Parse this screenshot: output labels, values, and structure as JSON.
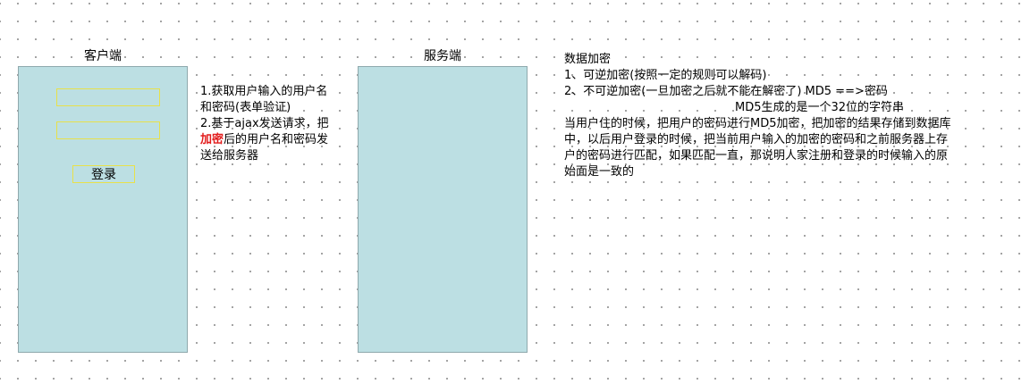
{
  "client": {
    "title": "客户端",
    "login_label": "登录"
  },
  "server": {
    "title": "服务端"
  },
  "steps": {
    "line1": "1.获取用户输入的用户名",
    "line2": "和密码(表单验证)",
    "line3": "2.基于ajax发送请求，把",
    "line4_highlight": "加密",
    "line4_rest": "后的用户名和密码发",
    "line5": "送给服务器"
  },
  "notes": {
    "heading": "数据加密",
    "item1": "1、可逆加密(按照一定的规则可以解码)",
    "item2": "2、不可逆加密(一旦加密之后就不能在解密了)  MD5 ==>密码",
    "md5_note": "MD5生成的是一个32位的字符串",
    "para1": "当用户住的时候，把用户的密码进行MD5加密，把加密的结果存储到数据库",
    "para2": "中，以后用户登录的时候，把当前用户输入的加密的密码和之前服务器上存",
    "para3": "户的密码进行匹配，如果匹配一直，那说明人家注册和登录的时候输入的原",
    "para4": "始面是一致的"
  },
  "colors": {
    "panel_fill": "#bcdfe3",
    "field_border": "#e8e14a",
    "highlight": "#e21c1c"
  }
}
